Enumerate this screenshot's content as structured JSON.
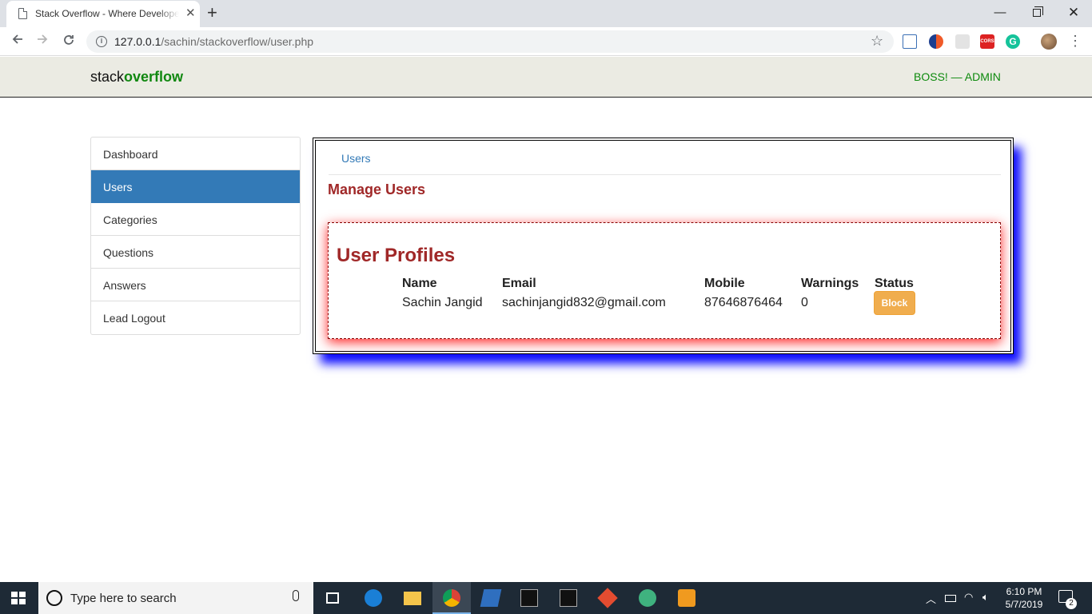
{
  "browser": {
    "tab_title": "Stack Overflow - Where Developers",
    "tab_close": "✕",
    "new_tab": "+",
    "url_host": "127.0.0.1",
    "url_path": "/sachin/stackoverflow/user.php",
    "window": {
      "minimize": "—",
      "close": "✕"
    },
    "extension_icons": [
      "download-extension-icon",
      "swirl-extension-icon",
      "blank-extension-icon",
      "cors-extension-icon",
      "grammarly-extension-icon"
    ],
    "ext_cors_label": "CORS",
    "ext_grammarly_label": "G"
  },
  "site": {
    "brand_plain": "stack",
    "brand_bold": "overflow",
    "admin_label": "BOSS! — ADMIN"
  },
  "sidebar": {
    "items": [
      {
        "label": "Dashboard",
        "active": false
      },
      {
        "label": "Users",
        "active": true
      },
      {
        "label": "Categories",
        "active": false
      },
      {
        "label": "Questions",
        "active": false
      },
      {
        "label": "Answers",
        "active": false
      },
      {
        "label": "Lead Logout",
        "active": false
      }
    ],
    "active_color": "#337ab7"
  },
  "main": {
    "breadcrumb": "Users",
    "title": "Manage Users",
    "profiles_title": "User Profiles",
    "columns": [
      "Name",
      "Email",
      "Mobile",
      "Warnings",
      "Status"
    ],
    "rows": [
      {
        "name": "Sachin Jangid",
        "email": "sachinjangid832@gmail.com",
        "mobile": "87646876464",
        "warnings": "0",
        "status_button": "Block"
      }
    ],
    "title_color": "#a02828",
    "button_color": "#f0ad4e"
  },
  "taskbar": {
    "search_placeholder": "Type here to search",
    "time": "6:10 PM",
    "date": "5/7/2019",
    "notification_count": "2",
    "apps": [
      "task-view-icon",
      "edge-icon",
      "file-explorer-icon",
      "chrome-icon",
      "powershell-icon",
      "terminal-icon",
      "terminal-icon",
      "git-icon",
      "atom-icon",
      "sublime-icon"
    ]
  }
}
